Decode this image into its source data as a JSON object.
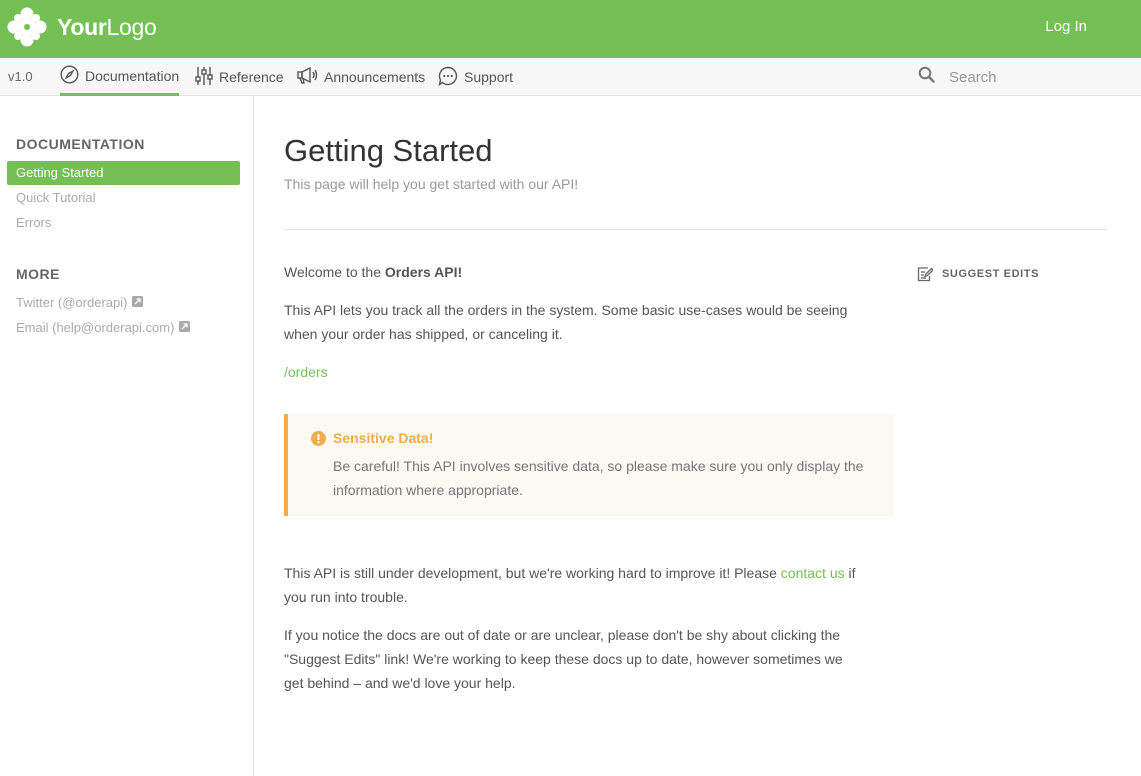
{
  "header": {
    "logo_bold": "Your",
    "logo_light": "Logo",
    "login_label": "Log In"
  },
  "nav": {
    "version": "v1.0",
    "items": [
      {
        "label": "Documentation",
        "icon": "compass-icon",
        "active": true
      },
      {
        "label": "Reference",
        "icon": "sliders-icon"
      },
      {
        "label": "Announcements",
        "icon": "megaphone-icon"
      },
      {
        "label": "Support",
        "icon": "chat-bubble-icon"
      }
    ],
    "search_placeholder": "Search"
  },
  "sidebar": {
    "documentation_heading": "DOCUMENTATION",
    "documentation_items": [
      "Getting Started",
      "Quick Tutorial",
      "Errors"
    ],
    "more_heading": "MORE",
    "more_items": [
      "Twitter (@orderapi)",
      "Email (help@orderapi.com)"
    ]
  },
  "page": {
    "title": "Getting Started",
    "subtitle": "This page will help you get started with our API!",
    "welcome_prefix": "Welcome to the ",
    "welcome_bold": "Orders API!",
    "intro_line1": "This API lets you track all the orders in the system. Some basic use-cases would be seeing",
    "intro_line2": "when your order has shipped, or canceling it.",
    "orders_link": "/orders",
    "callout_title": "Sensitive Data!",
    "callout_line1": "Be careful! This API involves sensitive data, so please make sure you only display the",
    "callout_line2": "information where appropriate.",
    "dev_prefix": "This API is still under development, but we're working hard to improve it! Please ",
    "dev_link": "contact us",
    "dev_suffix": " if",
    "dev_line2": "you run into trouble.",
    "notice_line1": "If you notice the docs are out of date or are unclear, please don't be shy about clicking the",
    "notice_line2": "\"Suggest Edits\" link! We're working to keep these docs up to date, however sometimes we",
    "notice_line3": "get behind – and we'd love your help.",
    "suggest_edits": "SUGGEST EDITS"
  },
  "colors": {
    "brand": "#74c054",
    "warning": "#f0ad4e"
  }
}
